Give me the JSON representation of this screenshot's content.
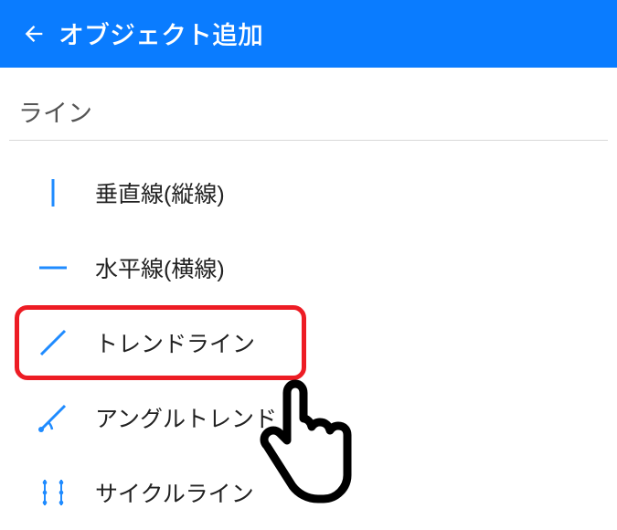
{
  "header": {
    "title": "オブジェクト追加"
  },
  "section": {
    "title": "ライン"
  },
  "items": [
    {
      "label": "垂直線(縦線)",
      "icon": "vertical-line-icon"
    },
    {
      "label": "水平線(横線)",
      "icon": "horizontal-line-icon"
    },
    {
      "label": "トレンドライン",
      "icon": "trend-line-icon",
      "highlighted": true
    },
    {
      "label": "アングルトレンド",
      "icon": "angle-trend-icon"
    },
    {
      "label": "サイクルライン",
      "icon": "cycle-line-icon"
    }
  ],
  "accent_color": "#0a7cff",
  "highlight_color": "#ed1c24"
}
